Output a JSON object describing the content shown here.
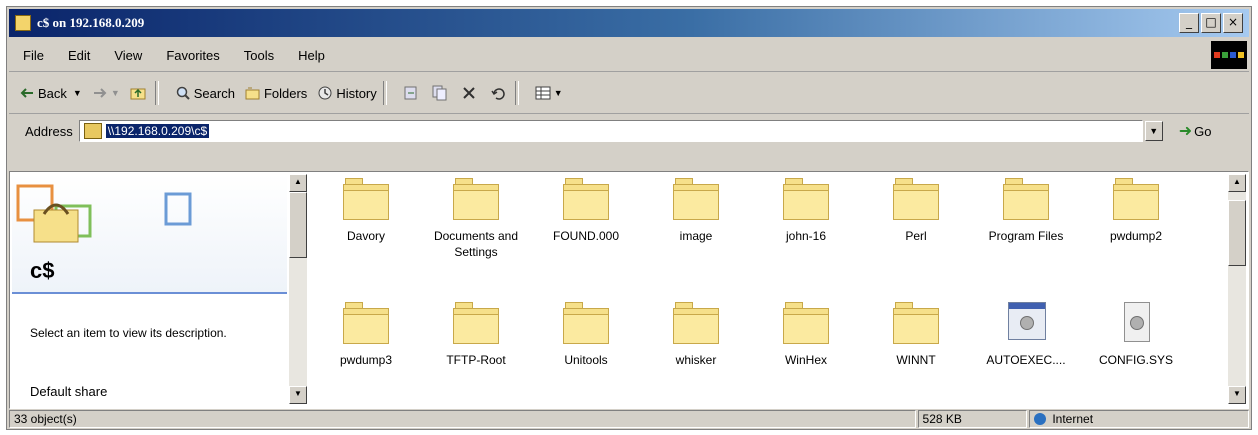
{
  "window": {
    "title": "c$ on 192.168.0.209"
  },
  "window_buttons": {
    "minimize": "_",
    "maximize": "□",
    "close": "×"
  },
  "menu": [
    "File",
    "Edit",
    "View",
    "Favorites",
    "Tools",
    "Help"
  ],
  "toolbar": {
    "back": "Back",
    "search": "Search",
    "folders": "Folders",
    "history": "History"
  },
  "address": {
    "label": "Address",
    "value": "\\\\192.168.0.209\\c$",
    "go": "Go"
  },
  "left_pane": {
    "title": "c$",
    "description": "Select an item to view its description.",
    "share_type": "Default share"
  },
  "items": [
    {
      "name": "Davory",
      "type": "folder"
    },
    {
      "name": "Documents and Settings",
      "type": "folder"
    },
    {
      "name": "FOUND.000",
      "type": "folder"
    },
    {
      "name": "image",
      "type": "folder"
    },
    {
      "name": "john-16",
      "type": "folder"
    },
    {
      "name": "Perl",
      "type": "folder"
    },
    {
      "name": "Program Files",
      "type": "folder"
    },
    {
      "name": "pwdump2",
      "type": "folder"
    },
    {
      "name": "pwdump3",
      "type": "folder"
    },
    {
      "name": "TFTP-Root",
      "type": "folder"
    },
    {
      "name": "Unitools",
      "type": "folder"
    },
    {
      "name": "whisker",
      "type": "folder"
    },
    {
      "name": "WinHex",
      "type": "folder"
    },
    {
      "name": "WINNT",
      "type": "folder"
    },
    {
      "name": "AUTOEXEC....",
      "type": "system-file"
    },
    {
      "name": "CONFIG.SYS",
      "type": "config-file"
    }
  ],
  "status": {
    "objects": "33 object(s)",
    "size": "528 KB",
    "zone": "Internet"
  },
  "colors": {
    "titlebar_start": "#0a246a",
    "titlebar_end": "#a6caf0",
    "chrome": "#d4d0c8",
    "folder": "#f6e08a",
    "selection": "#0a246a"
  }
}
